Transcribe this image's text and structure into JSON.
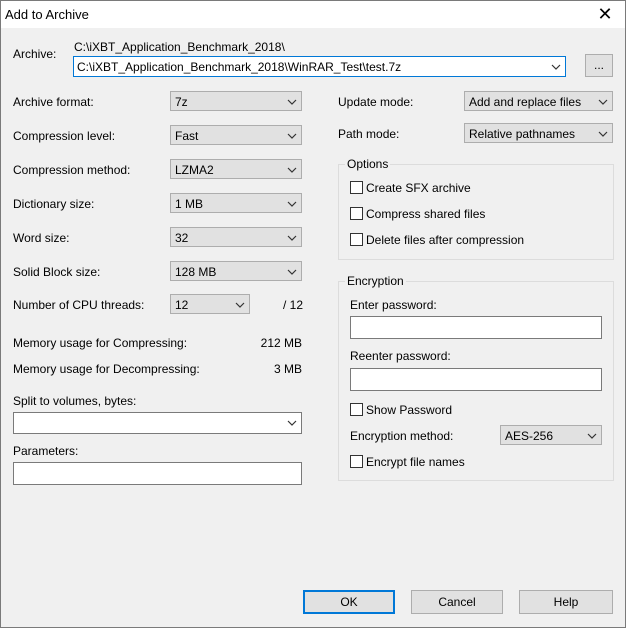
{
  "window": {
    "title": "Add to Archive",
    "close_glyph": "✕"
  },
  "archive": {
    "label": "Archive:",
    "current_path": "C:\\iXBT_Application_Benchmark_2018\\",
    "value": "C:\\iXBT_Application_Benchmark_2018\\WinRAR_Test\\test.7z",
    "browse_label": "..."
  },
  "left": {
    "archive_format": {
      "label": "Archive format:",
      "value": "7z"
    },
    "compression_level": {
      "label": "Compression level:",
      "value": "Fast"
    },
    "compression_method": {
      "label": "Compression method:",
      "value": "LZMA2"
    },
    "dictionary_size": {
      "label": "Dictionary size:",
      "value": "1 MB"
    },
    "word_size": {
      "label": "Word size:",
      "value": "32"
    },
    "solid_block_size": {
      "label": "Solid Block size:",
      "value": "128 MB"
    },
    "cpu_threads": {
      "label": "Number of CPU threads:",
      "value": "12",
      "max": "/ 12"
    },
    "mem_compress": {
      "label": "Memory usage for Compressing:",
      "value": "212 MB"
    },
    "mem_decompress": {
      "label": "Memory usage for Decompressing:",
      "value": "3 MB"
    },
    "split": {
      "label": "Split to volumes, bytes:",
      "value": ""
    },
    "parameters": {
      "label": "Parameters:",
      "value": ""
    }
  },
  "right": {
    "update_mode": {
      "label": "Update mode:",
      "value": "Add and replace files"
    },
    "path_mode": {
      "label": "Path mode:",
      "value": "Relative pathnames"
    },
    "options": {
      "title": "Options",
      "create_sfx": "Create SFX archive",
      "compress_shared": "Compress shared files",
      "delete_after": "Delete files after compression"
    },
    "encryption": {
      "title": "Encryption",
      "enter_password": "Enter password:",
      "reenter_password": "Reenter password:",
      "show_password": "Show Password",
      "method_label": "Encryption method:",
      "method_value": "AES-256",
      "encrypt_names": "Encrypt file names"
    }
  },
  "buttons": {
    "ok": "OK",
    "cancel": "Cancel",
    "help": "Help"
  }
}
